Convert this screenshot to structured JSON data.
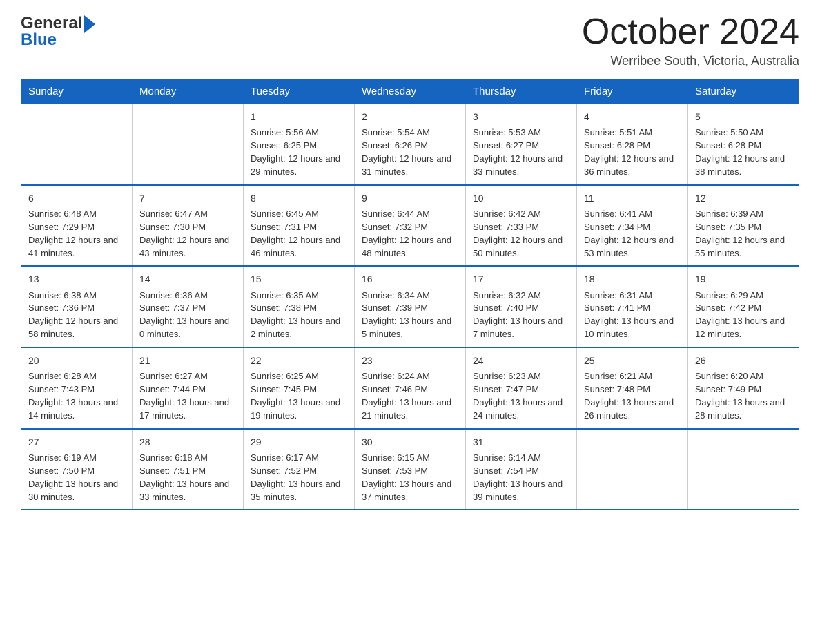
{
  "logo": {
    "general": "General",
    "blue": "Blue"
  },
  "header": {
    "month_year": "October 2024",
    "location": "Werribee South, Victoria, Australia"
  },
  "days_of_week": [
    "Sunday",
    "Monday",
    "Tuesday",
    "Wednesday",
    "Thursday",
    "Friday",
    "Saturday"
  ],
  "weeks": [
    [
      {
        "day": "",
        "sunrise": "",
        "sunset": "",
        "daylight": ""
      },
      {
        "day": "",
        "sunrise": "",
        "sunset": "",
        "daylight": ""
      },
      {
        "day": "1",
        "sunrise": "Sunrise: 5:56 AM",
        "sunset": "Sunset: 6:25 PM",
        "daylight": "Daylight: 12 hours and 29 minutes."
      },
      {
        "day": "2",
        "sunrise": "Sunrise: 5:54 AM",
        "sunset": "Sunset: 6:26 PM",
        "daylight": "Daylight: 12 hours and 31 minutes."
      },
      {
        "day": "3",
        "sunrise": "Sunrise: 5:53 AM",
        "sunset": "Sunset: 6:27 PM",
        "daylight": "Daylight: 12 hours and 33 minutes."
      },
      {
        "day": "4",
        "sunrise": "Sunrise: 5:51 AM",
        "sunset": "Sunset: 6:28 PM",
        "daylight": "Daylight: 12 hours and 36 minutes."
      },
      {
        "day": "5",
        "sunrise": "Sunrise: 5:50 AM",
        "sunset": "Sunset: 6:28 PM",
        "daylight": "Daylight: 12 hours and 38 minutes."
      }
    ],
    [
      {
        "day": "6",
        "sunrise": "Sunrise: 6:48 AM",
        "sunset": "Sunset: 7:29 PM",
        "daylight": "Daylight: 12 hours and 41 minutes."
      },
      {
        "day": "7",
        "sunrise": "Sunrise: 6:47 AM",
        "sunset": "Sunset: 7:30 PM",
        "daylight": "Daylight: 12 hours and 43 minutes."
      },
      {
        "day": "8",
        "sunrise": "Sunrise: 6:45 AM",
        "sunset": "Sunset: 7:31 PM",
        "daylight": "Daylight: 12 hours and 46 minutes."
      },
      {
        "day": "9",
        "sunrise": "Sunrise: 6:44 AM",
        "sunset": "Sunset: 7:32 PM",
        "daylight": "Daylight: 12 hours and 48 minutes."
      },
      {
        "day": "10",
        "sunrise": "Sunrise: 6:42 AM",
        "sunset": "Sunset: 7:33 PM",
        "daylight": "Daylight: 12 hours and 50 minutes."
      },
      {
        "day": "11",
        "sunrise": "Sunrise: 6:41 AM",
        "sunset": "Sunset: 7:34 PM",
        "daylight": "Daylight: 12 hours and 53 minutes."
      },
      {
        "day": "12",
        "sunrise": "Sunrise: 6:39 AM",
        "sunset": "Sunset: 7:35 PM",
        "daylight": "Daylight: 12 hours and 55 minutes."
      }
    ],
    [
      {
        "day": "13",
        "sunrise": "Sunrise: 6:38 AM",
        "sunset": "Sunset: 7:36 PM",
        "daylight": "Daylight: 12 hours and 58 minutes."
      },
      {
        "day": "14",
        "sunrise": "Sunrise: 6:36 AM",
        "sunset": "Sunset: 7:37 PM",
        "daylight": "Daylight: 13 hours and 0 minutes."
      },
      {
        "day": "15",
        "sunrise": "Sunrise: 6:35 AM",
        "sunset": "Sunset: 7:38 PM",
        "daylight": "Daylight: 13 hours and 2 minutes."
      },
      {
        "day": "16",
        "sunrise": "Sunrise: 6:34 AM",
        "sunset": "Sunset: 7:39 PM",
        "daylight": "Daylight: 13 hours and 5 minutes."
      },
      {
        "day": "17",
        "sunrise": "Sunrise: 6:32 AM",
        "sunset": "Sunset: 7:40 PM",
        "daylight": "Daylight: 13 hours and 7 minutes."
      },
      {
        "day": "18",
        "sunrise": "Sunrise: 6:31 AM",
        "sunset": "Sunset: 7:41 PM",
        "daylight": "Daylight: 13 hours and 10 minutes."
      },
      {
        "day": "19",
        "sunrise": "Sunrise: 6:29 AM",
        "sunset": "Sunset: 7:42 PM",
        "daylight": "Daylight: 13 hours and 12 minutes."
      }
    ],
    [
      {
        "day": "20",
        "sunrise": "Sunrise: 6:28 AM",
        "sunset": "Sunset: 7:43 PM",
        "daylight": "Daylight: 13 hours and 14 minutes."
      },
      {
        "day": "21",
        "sunrise": "Sunrise: 6:27 AM",
        "sunset": "Sunset: 7:44 PM",
        "daylight": "Daylight: 13 hours and 17 minutes."
      },
      {
        "day": "22",
        "sunrise": "Sunrise: 6:25 AM",
        "sunset": "Sunset: 7:45 PM",
        "daylight": "Daylight: 13 hours and 19 minutes."
      },
      {
        "day": "23",
        "sunrise": "Sunrise: 6:24 AM",
        "sunset": "Sunset: 7:46 PM",
        "daylight": "Daylight: 13 hours and 21 minutes."
      },
      {
        "day": "24",
        "sunrise": "Sunrise: 6:23 AM",
        "sunset": "Sunset: 7:47 PM",
        "daylight": "Daylight: 13 hours and 24 minutes."
      },
      {
        "day": "25",
        "sunrise": "Sunrise: 6:21 AM",
        "sunset": "Sunset: 7:48 PM",
        "daylight": "Daylight: 13 hours and 26 minutes."
      },
      {
        "day": "26",
        "sunrise": "Sunrise: 6:20 AM",
        "sunset": "Sunset: 7:49 PM",
        "daylight": "Daylight: 13 hours and 28 minutes."
      }
    ],
    [
      {
        "day": "27",
        "sunrise": "Sunrise: 6:19 AM",
        "sunset": "Sunset: 7:50 PM",
        "daylight": "Daylight: 13 hours and 30 minutes."
      },
      {
        "day": "28",
        "sunrise": "Sunrise: 6:18 AM",
        "sunset": "Sunset: 7:51 PM",
        "daylight": "Daylight: 13 hours and 33 minutes."
      },
      {
        "day": "29",
        "sunrise": "Sunrise: 6:17 AM",
        "sunset": "Sunset: 7:52 PM",
        "daylight": "Daylight: 13 hours and 35 minutes."
      },
      {
        "day": "30",
        "sunrise": "Sunrise: 6:15 AM",
        "sunset": "Sunset: 7:53 PM",
        "daylight": "Daylight: 13 hours and 37 minutes."
      },
      {
        "day": "31",
        "sunrise": "Sunrise: 6:14 AM",
        "sunset": "Sunset: 7:54 PM",
        "daylight": "Daylight: 13 hours and 39 minutes."
      },
      {
        "day": "",
        "sunrise": "",
        "sunset": "",
        "daylight": ""
      },
      {
        "day": "",
        "sunrise": "",
        "sunset": "",
        "daylight": ""
      }
    ]
  ]
}
